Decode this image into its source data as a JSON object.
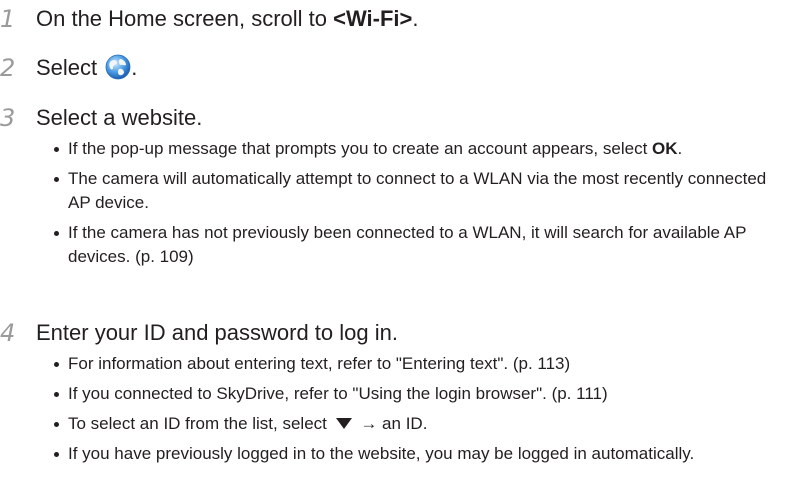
{
  "steps": [
    {
      "number": "1",
      "text_pre": "On the Home screen, scroll to ",
      "text_bold": "<Wi-Fi>",
      "text_post": "."
    },
    {
      "number": "2",
      "text_pre": "Select ",
      "icon": "globe-icon",
      "text_post": "."
    },
    {
      "number": "3",
      "text": "Select a website.",
      "bullets": [
        {
          "text_pre": "If the pop-up message that prompts you to create an account appears, select ",
          "text_bold": "OK",
          "text_post": "."
        },
        {
          "text": "The camera will automatically attempt to connect to a WLAN via the most recently connected AP device."
        },
        {
          "text": "If the camera has not previously been connected to a WLAN, it will search for available AP devices. (p. 109)"
        }
      ]
    },
    {
      "number": "4",
      "text": "Enter your ID and password to log in.",
      "bullets": [
        {
          "text": "For information about entering text, refer to \"Entering text\". (p. 113)"
        },
        {
          "text": "If you connected to SkyDrive, refer to \"Using the login browser\". (p. 111)"
        },
        {
          "text_pre": "To select an ID from the list, select ",
          "icon": "triangle-down-icon",
          "text_post": " → an ID."
        },
        {
          "text": "If you have previously logged in to the website, you may be logged in automatically."
        }
      ]
    }
  ]
}
